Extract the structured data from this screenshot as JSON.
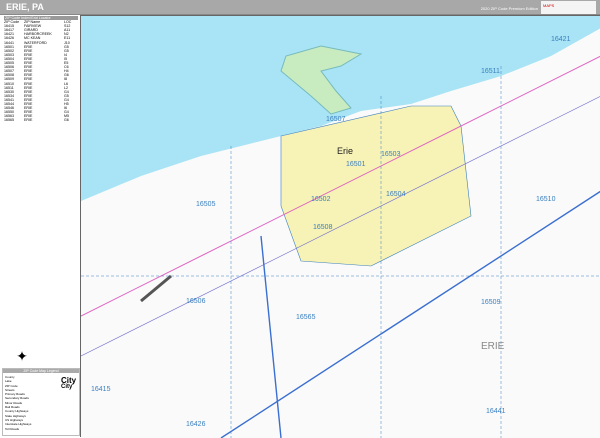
{
  "header": {
    "title": "ERIE, PA",
    "edition": "2020 ZIP Code Premium Edition",
    "logo": "MAPS"
  },
  "zip_table": {
    "title": "ZIP Code Index/Grid Locator",
    "columns": [
      "ZIP Code",
      "ZIP Name",
      "LOC"
    ],
    "rows": [
      [
        "16415",
        "FAIRVIEW",
        "S12"
      ],
      [
        "16417",
        "GIRARD",
        "A11"
      ],
      [
        "16421",
        "HARBORCREEK",
        "N2"
      ],
      [
        "16426",
        "MC KEAN",
        "E11"
      ],
      [
        "16441",
        "WATERFORD",
        "J10"
      ],
      [
        "16501",
        "ERIE",
        "G5"
      ],
      [
        "16502",
        "ERIE",
        "G5"
      ],
      [
        "16503",
        "ERIE",
        "I4"
      ],
      [
        "16504",
        "ERIE",
        "I5"
      ],
      [
        "16505",
        "ERIE",
        "E5"
      ],
      [
        "16506",
        "ERIE",
        "C6"
      ],
      [
        "16507",
        "ERIE",
        "H4"
      ],
      [
        "16508",
        "ERIE",
        "G6"
      ],
      [
        "16509",
        "ERIE",
        "I8"
      ],
      [
        "16510",
        "ERIE",
        "L6"
      ],
      [
        "16511",
        "ERIE",
        "L2"
      ],
      [
        "16530",
        "ERIE",
        "G4"
      ],
      [
        "16534",
        "ERIE",
        "G5"
      ],
      [
        "16541",
        "ERIE",
        "G4"
      ],
      [
        "16544",
        "ERIE",
        "H5"
      ],
      [
        "16546",
        "ERIE",
        "I6"
      ],
      [
        "16550",
        "ERIE",
        "G4"
      ],
      [
        "16563",
        "ERIE",
        "M5"
      ],
      [
        "16565",
        "ERIE",
        "G6"
      ]
    ]
  },
  "legend": {
    "title": "ZIP Code Map Legend",
    "items": [
      "County",
      "Lake",
      "ZIP Code",
      "Streets",
      "Primary Roads",
      "Secondary Roads",
      "Minor Roads",
      "Rail Roads",
      "County Highways",
      "State Highways",
      "US Highways",
      "Interstate Highways",
      "Toll Roads"
    ],
    "city_label": "City"
  },
  "map": {
    "city": "Erie",
    "county": "ERIE",
    "colors": {
      "lake": "#a8e4f5",
      "urban": "#f7f2b5",
      "zip_boundary": "#3a7fbf",
      "interstate": "#3a6fd0"
    },
    "zips": [
      {
        "code": "16421"
      },
      {
        "code": "16511"
      },
      {
        "code": "16507"
      },
      {
        "code": "16503"
      },
      {
        "code": "16505"
      },
      {
        "code": "16502"
      },
      {
        "code": "16504"
      },
      {
        "code": "16501"
      },
      {
        "code": "16510"
      },
      {
        "code": "16508"
      },
      {
        "code": "16506"
      },
      {
        "code": "16509"
      },
      {
        "code": "16565"
      },
      {
        "code": "16415"
      },
      {
        "code": "16426"
      },
      {
        "code": "16441"
      }
    ]
  }
}
